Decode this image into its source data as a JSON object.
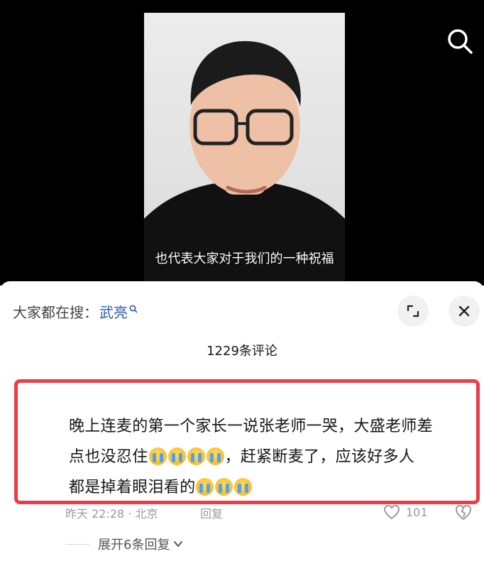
{
  "video": {
    "subtitle": "也代表大家对于我们的一种祝福"
  },
  "search_bar": {
    "prefix": "大家都在搜：",
    "keyword": "武亮"
  },
  "comments": {
    "count_label": "1229条评论",
    "items": [
      {
        "text_line1": "晚上连麦的第一个家长一说张老师一哭，大盛老师差",
        "text_line2_before": "点也没忍住",
        "text_line2_after": "，赶紧断麦了，应该好多人",
        "text_line3_before": "都是掉着眼泪看的",
        "meta": "昨天 22:28 · 北京",
        "reply_label": "回复",
        "like_count": "101"
      }
    ],
    "expand_replies_label": "展开6条回复"
  }
}
